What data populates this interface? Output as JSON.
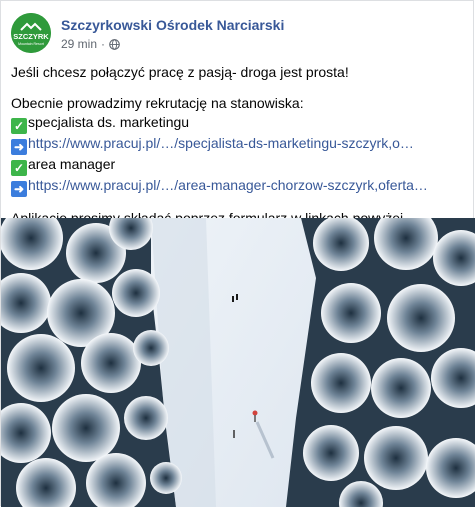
{
  "page": {
    "name": "Szczyrkowski Ośrodek Narciarski",
    "avatar_text": "SZCZYRK",
    "avatar_subtext": "Mountain Resort",
    "time": "29 min",
    "separator": "·",
    "privacy_icon": "globe-icon"
  },
  "post": {
    "line1": "Jeśli chcesz połączyć pracę z pasją- droga jest prosta!",
    "line2": "Obecnie prowadzimy rekrutację na stanowiska:",
    "jobs": [
      {
        "title": "specjalista ds. marketingu",
        "link": "https://www.pracuj.pl/…/specjalista-ds-marketingu-szczyrk,o…"
      },
      {
        "title": "area manager",
        "link": "https://www.pracuj.pl/…/area-manager-chorzow-szczyrk,oferta…"
      }
    ],
    "line_footer": "Aplikacje prosimy składać poprzez formularz w linkach powyżej."
  },
  "colors": {
    "brand_green": "#2f9a3b",
    "link": "#385898",
    "meta": "#606770",
    "check": "#3db54a",
    "arrow": "#3b7ddd"
  },
  "image": {
    "subject": "aerial snowy ski slope with frosted trees"
  }
}
